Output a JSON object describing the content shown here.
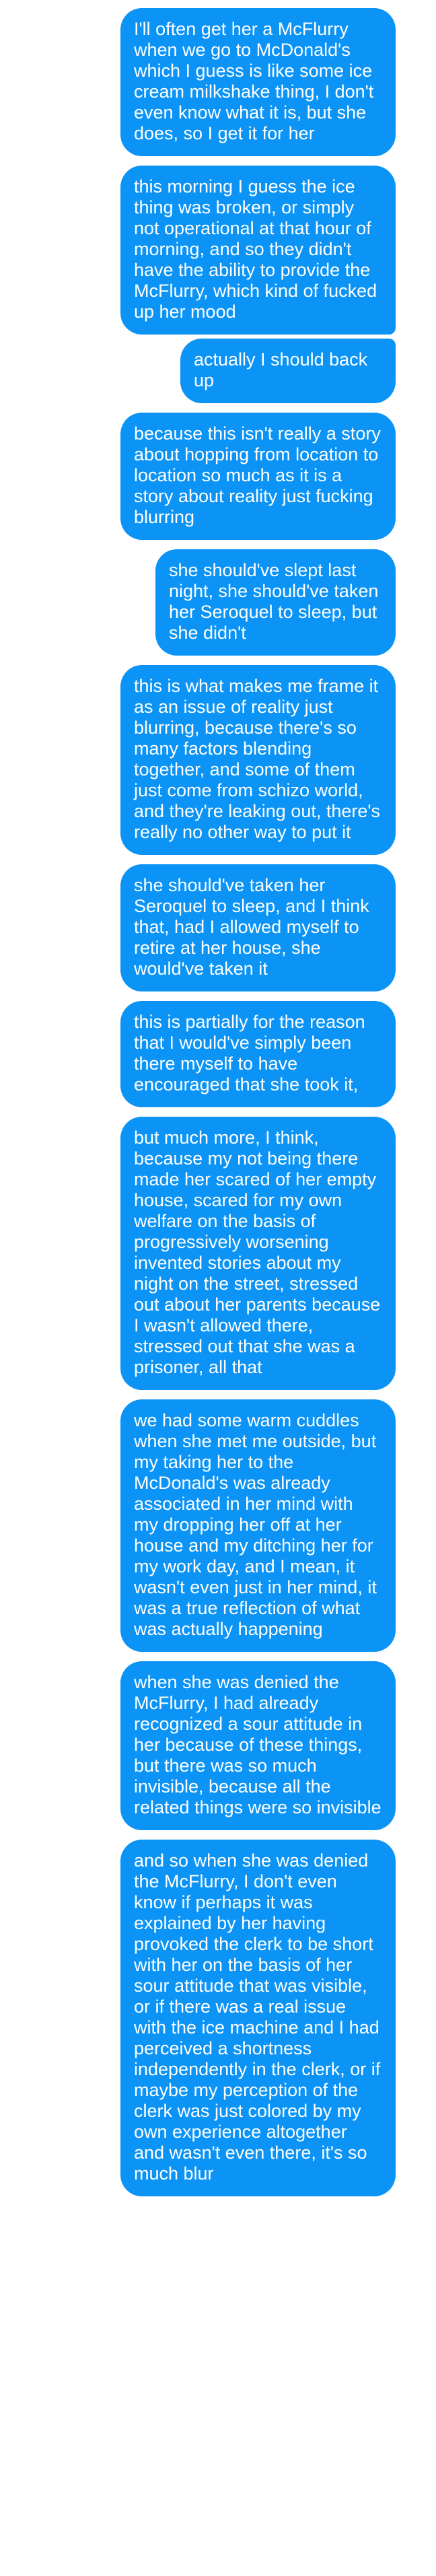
{
  "messages": [
    {
      "text": "I'll often get her a McFlurry when we go to McDonald's which I guess is like some ice cream milkshake thing, I don't even know what it is, but she does, so I get it for her"
    },
    {
      "text": "this morning I guess the ice thing was broken, or simply not operational at that hour of morning, and so they didn't have the ability to provide the McFlurry, which kind of fucked up her mood"
    },
    {
      "text": "actually I should back up"
    },
    {
      "text": "because this isn't really a story about hopping from location to location so much as it is a story about reality just fucking blurring"
    },
    {
      "text": "she should've slept last night, she should've taken her Seroquel to sleep, but she didn't"
    },
    {
      "text": "this is what makes me frame it as an issue of reality just blurring, because there's so many factors blending together, and some of them just come from schizo world, and they're leaking out, there's really no other way to put it"
    },
    {
      "text": "she should've taken her Seroquel to sleep, and I think that, had I allowed myself to retire at her house, she would've taken it"
    },
    {
      "text": "this is partially for the reason that I would've simply been there myself to have encouraged that she took it,"
    },
    {
      "text": "but much more, I think, because my not being there made her scared of her empty house, scared for my own welfare on the basis of progressively worsening invented stories about my night on the street, stressed out about her parents because I wasn't allowed there, stressed out that she was a prisoner, all that"
    },
    {
      "text": "we had some warm cuddles when she met me outside, but my taking her to the McDonald's was already associated in her mind with my dropping her off at her house and my ditching her for my work day, and I mean, it wasn't even just in her mind, it was a true reflection of what was actually happening"
    },
    {
      "text": "when she was denied the McFlurry, I had already recognized a sour attitude in her because of these things, but there was so much invisible, because all the related things were so invisible"
    },
    {
      "text": "and so when she was denied the McFlurry, I don't even know if perhaps it was explained by her having provoked the clerk to be short with her on the basis of her sour attitude that was visible, or if there was a real issue with the ice machine and I had perceived a shortness independently in the clerk, or if maybe my perception of the clerk was just colored by my own experience altogether and wasn't even there, it's so much blur"
    }
  ],
  "colors": {
    "bubble": "#0b93f6",
    "bubble_text": "#ffffff",
    "background": "#ffffff"
  }
}
